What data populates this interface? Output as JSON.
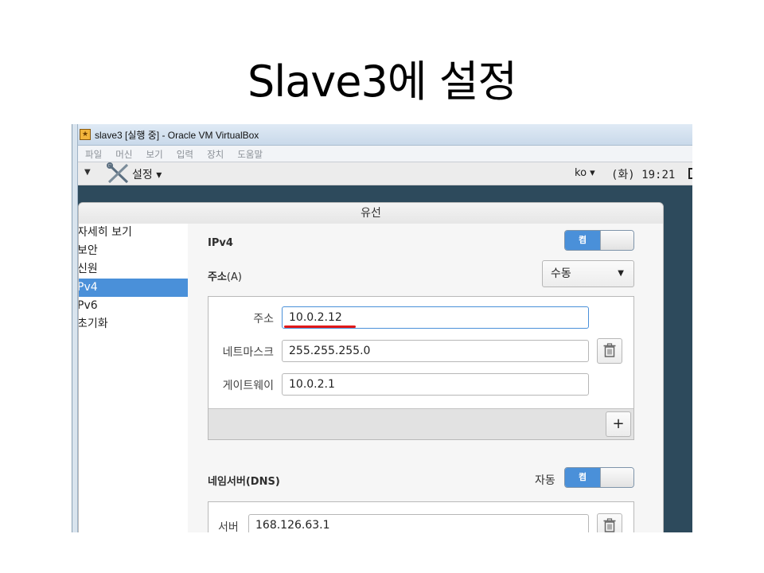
{
  "slide": {
    "title": "Slave3에 설정"
  },
  "window": {
    "title": "slave3 [실행 중] - Oracle VM VirtualBox",
    "menu": [
      "파일",
      "머신",
      "보기",
      "입력",
      "장치",
      "도움말"
    ]
  },
  "topbar": {
    "arrow": "▼",
    "settings_label": "설정 ▾",
    "lang": "ko ▾",
    "clock": "(화) 19:21"
  },
  "dialog": {
    "title": "유선",
    "sidebar": [
      "자세히 보기",
      "보안",
      "신원",
      "Pv4",
      "Pv6",
      "초기화"
    ],
    "selected_index": 3,
    "ipv4_label": "IPv4",
    "ipv4_toggle": "켬",
    "address_label_bold": "주소",
    "address_label_suffix": "(A)",
    "method_value": "수동",
    "method_caret": "▼",
    "fields": {
      "address_label": "주소",
      "address_value": "10.0.2.12",
      "netmask_label": "네트마스크",
      "netmask_value": "255.255.255.0",
      "gateway_label": "게이트웨이",
      "gateway_value": "10.0.2.1"
    },
    "add_button": "+",
    "dns_label_bold": "네임서버",
    "dns_label_suffix": "(DNS)",
    "dns_auto_label": "자동",
    "dns_toggle": "켬",
    "dns_server_label": "서버",
    "dns_server_value": "168.126.63.1"
  },
  "colors": {
    "accent": "#4a90d9",
    "annotation": "#e11818"
  }
}
